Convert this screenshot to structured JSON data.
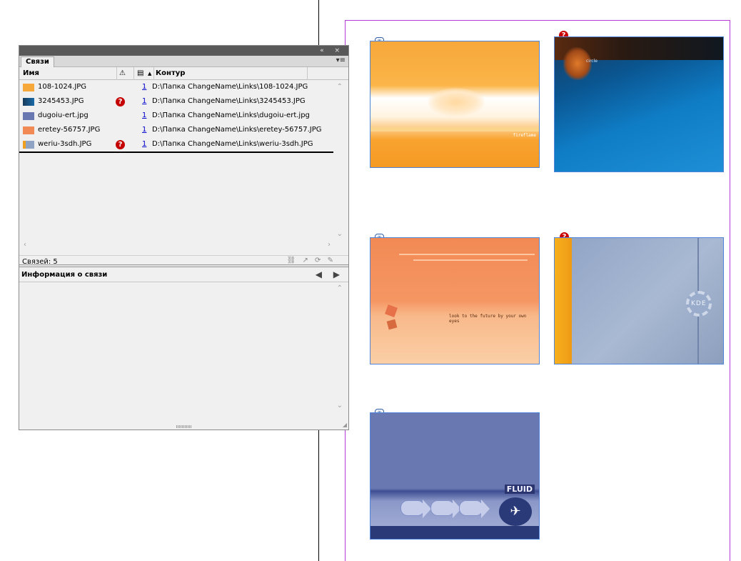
{
  "panel": {
    "tab_label": "Связи",
    "title_buttons": "« ×",
    "tab_menu": "▾≡",
    "columns": {
      "name": "Имя",
      "warn": "⚠",
      "page": "▤",
      "sort": "▲",
      "path": "Контур"
    },
    "rows": [
      {
        "name": "108-1024.JPG",
        "page": "1",
        "path": "D:\\Папка ChangeName\\Links\\108-1024.JPG",
        "missing": false,
        "thumb_color": "#f7a83a"
      },
      {
        "name": "3245453.JPG",
        "page": "1",
        "path": "D:\\Папка ChangeName\\Links\\3245453.JPG",
        "missing": true,
        "thumb_color": "#1a6aa8"
      },
      {
        "name": "dugoiu-ert.jpg",
        "page": "1",
        "path": "D:\\Папка ChangeName\\Links\\dugoiu-ert.jpg",
        "missing": false,
        "thumb_color": "#6a78b2"
      },
      {
        "name": "eretey-56757.JPG",
        "page": "1",
        "path": "D:\\Папка ChangeName\\Links\\eretey-56757.JPG",
        "missing": false,
        "thumb_color": "#f28a55"
      },
      {
        "name": "weriu-3sdh.JPG",
        "page": "1",
        "path": "D:\\Папка ChangeName\\Links\\weriu-3sdh.JPG",
        "missing": true,
        "thumb_color": "#8fa3c4"
      }
    ],
    "missing_icon": "?",
    "links_count": "Связей: 5",
    "status_tools": "⛓ ↗ ⟳ ✎",
    "info_title": "Информация о связи",
    "info_arrows": "◀ ▶"
  },
  "canvas": {
    "link_badge": "∞",
    "missing_badge": "?",
    "image3_text": "look to the future by your own eyes",
    "image4_text": "KDE",
    "image5_text": "FLUID",
    "image2_text": "circle",
    "image1_text": "fireflame"
  }
}
